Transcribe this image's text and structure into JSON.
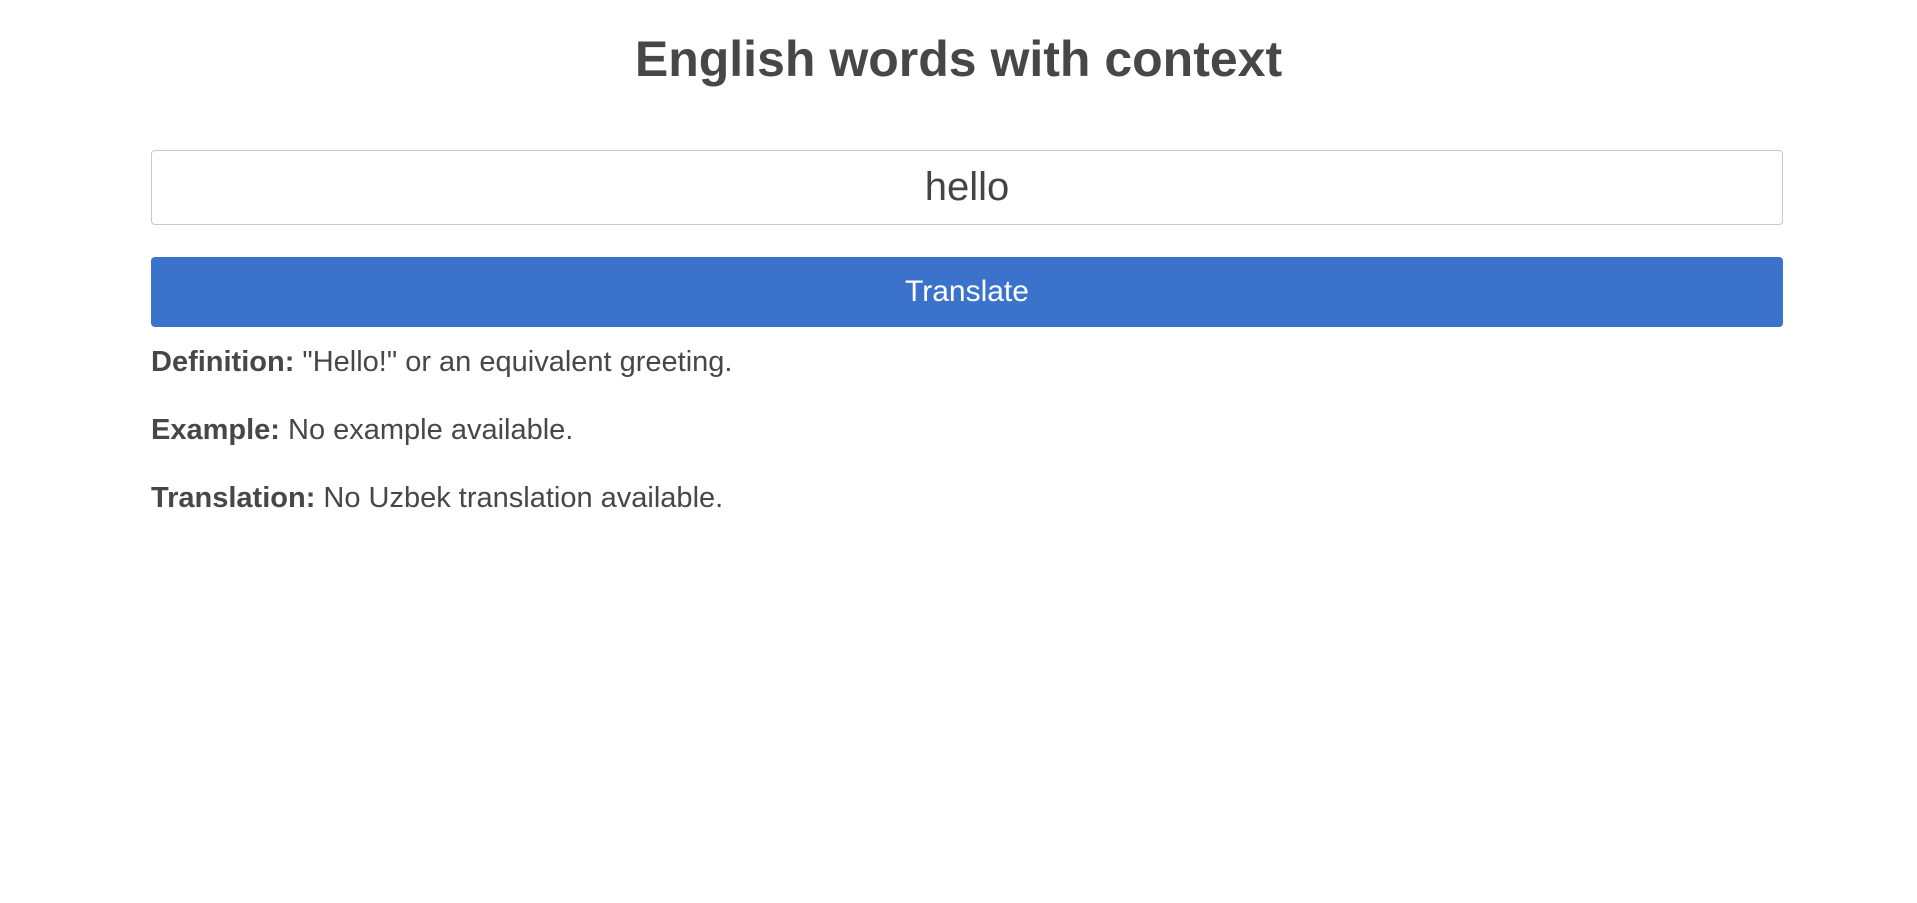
{
  "page": {
    "title": "English words with context"
  },
  "search": {
    "value": "hello",
    "button_label": "Translate"
  },
  "results": {
    "definition": {
      "label": "Definition:",
      "text": "\"Hello!\" or an equivalent greeting."
    },
    "example": {
      "label": "Example:",
      "text": "No example available."
    },
    "translation": {
      "label": "Translation:",
      "text": "No Uzbek translation available."
    }
  },
  "colors": {
    "accent": "#3a72cc",
    "text": "#474747",
    "border": "#c8c8c8"
  }
}
